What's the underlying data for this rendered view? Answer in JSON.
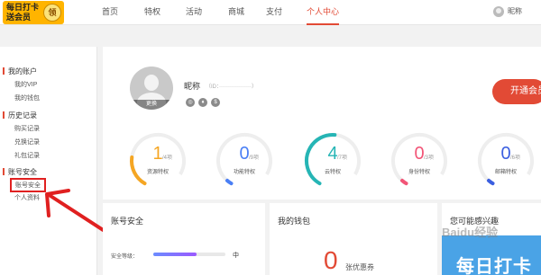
{
  "header": {
    "logo_line1": "每日打卡",
    "logo_line2": "送会员",
    "logo_badge": "领",
    "nav": [
      {
        "label": "首页"
      },
      {
        "label": "特权"
      },
      {
        "label": "活动"
      },
      {
        "label": "商城"
      },
      {
        "label": "支付"
      },
      {
        "label": "个人中心"
      }
    ],
    "user_name": "昵称"
  },
  "sidebar": {
    "sections": [
      {
        "title": "我的账户",
        "items": [
          "我的VIP",
          "我的钱包"
        ]
      },
      {
        "title": "历史记录",
        "items": [
          "购买记录",
          "兑换记录",
          "礼包记录"
        ]
      },
      {
        "title": "账号安全",
        "items": [
          "账号安全",
          "个人资料"
        ]
      }
    ]
  },
  "profile": {
    "avatar_edit": "更换",
    "nickname": "昵称",
    "id_label": "（ID：",
    "badges": [
      "◎",
      "♦",
      "$"
    ],
    "open_button": "开通会员",
    "stats": [
      {
        "value": "1",
        "unit": "/4项",
        "label": "资源特权",
        "color": "#f5a623",
        "fraction": 0.25
      },
      {
        "value": "0",
        "unit": "/9项",
        "label": "功能特权",
        "color": "#4a7ff5",
        "fraction": 0.04
      },
      {
        "value": "4",
        "unit": "/7项",
        "label": "云特权",
        "color": "#26b5b5",
        "fraction": 0.57
      },
      {
        "value": "0",
        "unit": "/3项",
        "label": "身份特权",
        "color": "#f25577",
        "fraction": 0.04
      },
      {
        "value": "0",
        "unit": "/6项",
        "label": "邮箱特权",
        "color": "#3b5fe0",
        "fraction": 0.04
      }
    ]
  },
  "cards": {
    "security_title": "账号安全",
    "security_level_label": "安全等级：",
    "security_level_value": "中",
    "security_level_fraction": 0.6,
    "wallet_title": "我的钱包",
    "wallet_coupon_count": "0",
    "wallet_coupon_label": "张优惠券",
    "interest_title": "您可能感兴趣",
    "banner_text": "每日打卡"
  },
  "watermark": "Baidu经验"
}
